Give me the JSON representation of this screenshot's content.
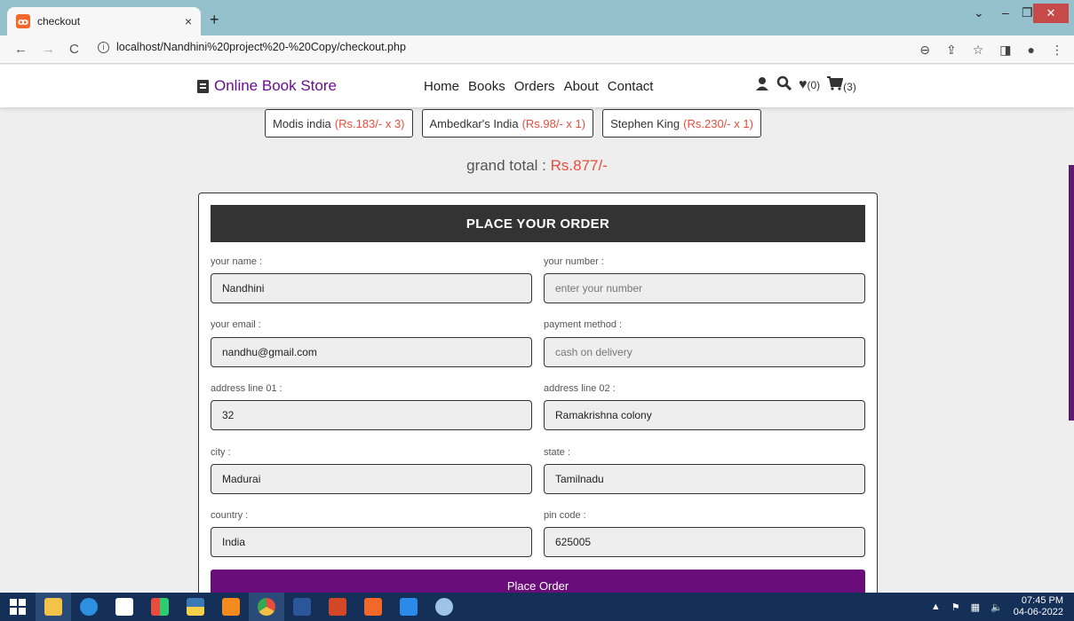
{
  "browser": {
    "tab_title": "checkout",
    "tab_close": "×",
    "new_tab": "+",
    "url": "localhost/Nandhini%20project%20-%20Copy/checkout.php",
    "minimize": "–",
    "restore": "❐",
    "close": "✕",
    "chevron": "⌄"
  },
  "site": {
    "logo_text": "Online Book Store",
    "nav": [
      "Home",
      "Books",
      "Orders",
      "About",
      "Contact"
    ],
    "wishlist_count": "(0)",
    "cart_count": "(3)"
  },
  "order": {
    "items": [
      {
        "name": "Modis india",
        "price": "(Rs.183/- x 3)"
      },
      {
        "name": "Ambedkar's India",
        "price": "(Rs.98/- x 1)"
      },
      {
        "name": "Stephen King",
        "price": "(Rs.230/- x 1)"
      }
    ],
    "grand_label": "grand total : ",
    "grand_value": "Rs.877/-"
  },
  "form": {
    "title": "PLACE YOUR ORDER",
    "name_label": "your name :",
    "name_value": "Nandhini",
    "number_label": "your number :",
    "number_placeholder": "enter your number",
    "email_label": "your email :",
    "email_value": "nandhu@gmail.com",
    "method_label": "payment method :",
    "method_value": "cash on delivery",
    "addr1_label": "address line 01 :",
    "addr1_value": "32",
    "addr2_label": "address line 02 :",
    "addr2_value": "Ramakrishna colony",
    "city_label": "city :",
    "city_value": "Madurai",
    "state_label": "state :",
    "state_value": "Tamilnadu",
    "country_label": "country :",
    "country_value": "India",
    "pin_label": "pin code :",
    "pin_value": "625005",
    "submit_label": "Place Order"
  },
  "taskbar": {
    "time": "07:45 PM",
    "date": "04-06-2022"
  },
  "colors": {
    "accent": "#6a0d91",
    "price_red": "#e74c3c",
    "header_dark": "#333333"
  }
}
